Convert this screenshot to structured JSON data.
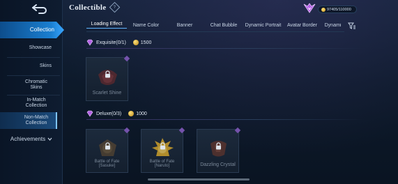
{
  "header": {
    "title": "Collectible",
    "help_label": "?",
    "currency_value": "97405/110000"
  },
  "sidebar": {
    "active_item": "Collection",
    "items": [
      {
        "label": "Showcase"
      },
      {
        "label": "Skins"
      },
      {
        "label": "Chromatic Skins"
      },
      {
        "label": "In-Match Collection"
      },
      {
        "label": "Non-Match Collection"
      }
    ],
    "achievements_label": "Achievements"
  },
  "tabs": [
    {
      "label": "Loading Effect"
    },
    {
      "label": "Name Color"
    },
    {
      "label": "Banner"
    },
    {
      "label": "Chat Bubble"
    },
    {
      "label": "Dynamic Portrait"
    },
    {
      "label": "Avatar Border"
    },
    {
      "label": "Dynami"
    }
  ],
  "sections": [
    {
      "title": "Exquisite(0/1)",
      "cost": "1500",
      "items": [
        {
          "name": "Scarlet Shine"
        }
      ]
    },
    {
      "title": "Deluxe(0/3)",
      "cost": "1000",
      "items": [
        {
          "name_line1": "Battle of Fate",
          "name_line2": "[Sasuke]"
        },
        {
          "name_line1": "Battle of Fate",
          "name_line2": "[Naruto]"
        },
        {
          "name": "Dazzling Crystal"
        }
      ]
    }
  ],
  "colors": {
    "accent_blue": "#1a7fd1",
    "gem_purple": "#b463e6",
    "coin_gold": "#e2b13c"
  }
}
